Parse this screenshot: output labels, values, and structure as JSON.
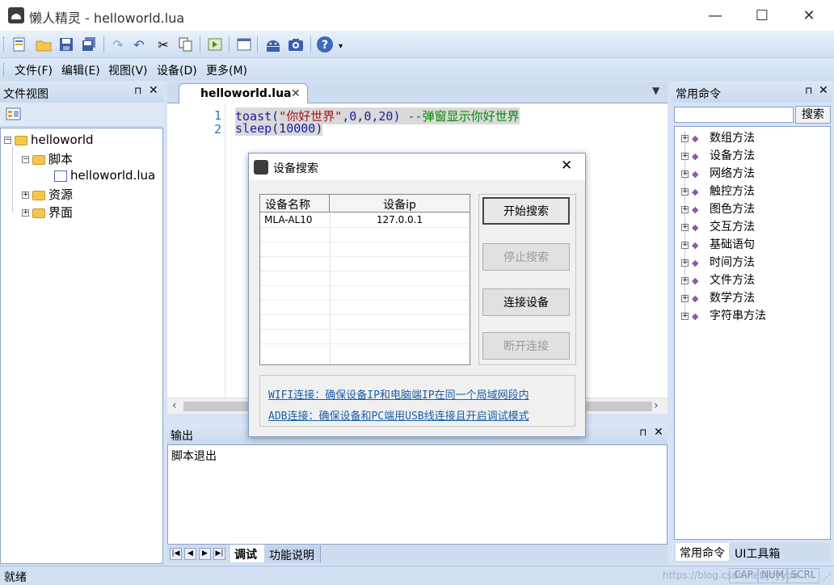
{
  "window": {
    "title": "懒人精灵 - helloworld.lua"
  },
  "window_controls": {
    "minimize": "—",
    "maximize": "☐",
    "close": "✕"
  },
  "toolbar": {
    "icons": [
      "new-file-icon",
      "open-folder-icon",
      "save-icon",
      "save-all-icon",
      "redo-icon",
      "undo-icon",
      "cut-icon",
      "copy-icon",
      "run-icon",
      "window-icon",
      "android-icon",
      "camera-icon",
      "help-icon"
    ]
  },
  "menu": [
    "文件(F)",
    "编辑(E)",
    "视图(V)",
    "设备(D)",
    "更多(M)"
  ],
  "file_panel": {
    "title": "文件视图",
    "tree": {
      "root": "helloworld",
      "script_folder": "脚本",
      "script_file": "helloworld.lua",
      "resources": "资源",
      "ui": "界面"
    }
  },
  "editor": {
    "tab": "helloworld.lua",
    "lines": [
      {
        "num": "1",
        "code": "toast(",
        "str": "\"你好世界\"",
        "rest": ",0,0,20) ",
        "comment": "--弹窗显示你好世界"
      },
      {
        "num": "2",
        "code": "sleep",
        "rest": "(10000)"
      }
    ]
  },
  "output_panel": {
    "title": "输出",
    "text": "脚本退出",
    "tabs": [
      "调试",
      "功能说明"
    ]
  },
  "dialog": {
    "title": "设备搜索",
    "columns": [
      "设备名称",
      "设备ip"
    ],
    "rows": [
      {
        "name": "MLA-AL10",
        "ip": "127.0.0.1"
      }
    ],
    "buttons": {
      "start": "开始搜索",
      "stop": "停止搜索",
      "connect": "连接设备",
      "disconnect": "断开连接"
    },
    "links": {
      "wifi": "WIFI连接：确保设备IP和电脑端IP在同一个局域网段内",
      "adb": "ADB连接：确保设备和PC端用USB线连接且开启调试模式"
    }
  },
  "command_panel": {
    "title": "常用命令",
    "search_button": "搜索",
    "search_value": "",
    "items": [
      "数组方法",
      "设备方法",
      "网络方法",
      "触控方法",
      "图色方法",
      "交互方法",
      "基础语句",
      "时间方法",
      "文件方法",
      "数学方法",
      "字符串方法"
    ],
    "tabs": [
      "常用命令",
      "UI工具箱"
    ]
  },
  "statusbar": {
    "text": "就绪",
    "indicators": [
      "CAP",
      "NUM",
      "SCRL"
    ],
    "watermark": "https://blog.csdn.net/joyyoo..."
  }
}
